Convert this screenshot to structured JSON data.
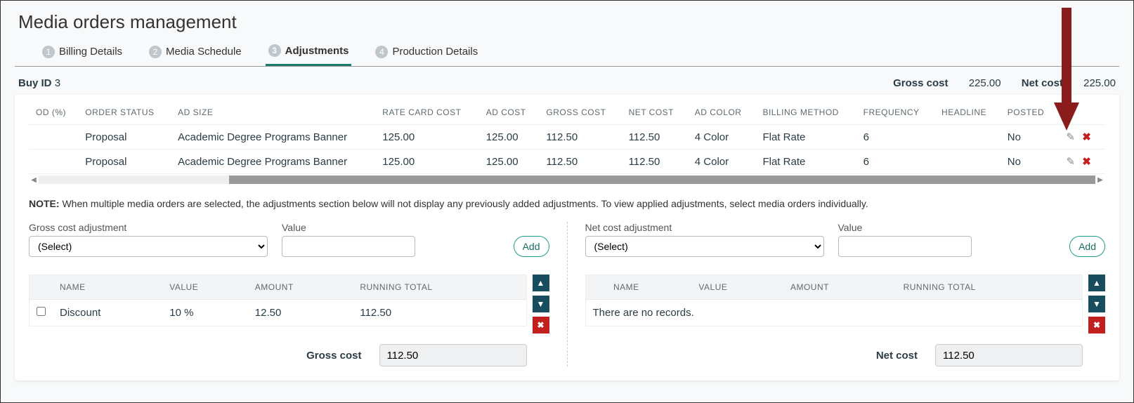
{
  "page_title": "Media orders management",
  "tabs": [
    {
      "num": "1",
      "label": "Billing Details"
    },
    {
      "num": "2",
      "label": "Media Schedule"
    },
    {
      "num": "3",
      "label": "Adjustments"
    },
    {
      "num": "4",
      "label": "Production Details"
    }
  ],
  "buy_id_label": "Buy ID",
  "buy_id_value": "3",
  "gross_cost_header_label": "Gross cost",
  "gross_cost_header_value": "225.00",
  "net_cost_header_label": "Net cost",
  "net_cost_header_value": "225.00",
  "orders_columns": [
    "OD (%)",
    "ORDER STATUS",
    "AD SIZE",
    "RATE CARD COST",
    "AD COST",
    "GROSS COST",
    "NET COST",
    "AD COLOR",
    "BILLING METHOD",
    "FREQUENCY",
    "HEADLINE",
    "POSTED",
    ""
  ],
  "orders_rows": [
    {
      "od": "",
      "status": "Proposal",
      "ad_size": "Academic Degree Programs Banner",
      "rate": "125.00",
      "ad_cost": "125.00",
      "gross": "112.50",
      "net": "112.50",
      "color": "4 Color",
      "billing": "Flat Rate",
      "freq": "6",
      "headline": "",
      "posted": "No"
    },
    {
      "od": "",
      "status": "Proposal",
      "ad_size": "Academic Degree Programs Banner",
      "rate": "125.00",
      "ad_cost": "125.00",
      "gross": "112.50",
      "net": "112.50",
      "color": "4 Color",
      "billing": "Flat Rate",
      "freq": "6",
      "headline": "",
      "posted": "No"
    }
  ],
  "note_label": "NOTE:",
  "note_text": " When multiple media orders are selected, the adjustments section below will not display any previously added adjustments. To view applied adjustments, select media orders individually.",
  "gross_adj_label": "Gross cost adjustment",
  "net_adj_label": "Net cost adjustment",
  "value_label": "Value",
  "select_placeholder": "(Select)",
  "add_label": "Add",
  "adj_columns": [
    "",
    "NAME",
    "VALUE",
    "AMOUNT",
    "RUNNING TOTAL"
  ],
  "gross_adj_rows": [
    {
      "name": "Discount",
      "value": "10 %",
      "amount": "12.50",
      "running": "112.50"
    }
  ],
  "no_records": "There are no records.",
  "gross_total_label": "Gross cost",
  "gross_total_value": "112.50",
  "net_total_label": "Net cost",
  "net_total_value": "112.50"
}
